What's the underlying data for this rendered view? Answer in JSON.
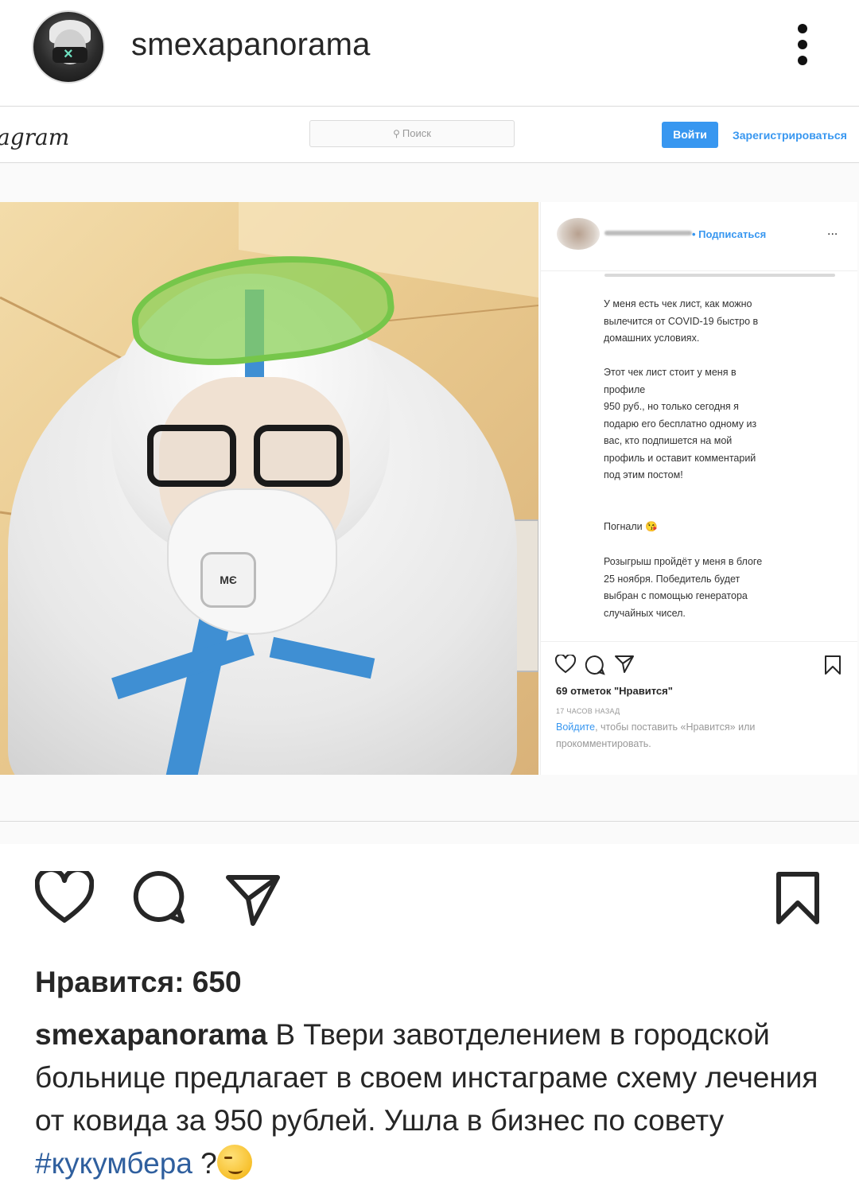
{
  "post": {
    "username": "smexapanorama",
    "likes_label": "Нравится: 650",
    "caption_user": "smexapanorama",
    "caption_text": " В Твери завотделением в городской больнице предлагает в своем инстаграме схему лечения от ковида за 950 рублей. Ушла в бизнес по совету ",
    "caption_hashtag": "#кукумбера",
    "caption_tail": " ?",
    "caption_emoji": "smirking-face-emoji"
  },
  "embedded": {
    "logo": "agram",
    "search_placeholder": "Поиск",
    "login_label": "Войти",
    "register_label": "Зарегистрироваться",
    "follow_label": "• Подписаться",
    "more_label": "...",
    "mask_text": "MЄ",
    "paragraph1": [
      "У меня есть чек лист, как можно",
      "вылечится от COVID-19 быстро в",
      "домашних условиях."
    ],
    "paragraph2": [
      "Этот чек лист стоит у меня в",
      "профиле",
      "950 руб., но только сегодня я",
      "подарю его бесплатно одному из",
      "вас, кто подпишется на мой",
      "профиль и оставит комментарий",
      "под этим постом!"
    ],
    "paragraph3": [
      "Погнали 😘"
    ],
    "paragraph4": [
      "Розыгрыш пройдёт у меня в блоге",
      "25 ноября. Победитель будет",
      "выбран с помощью генератора",
      "случайных чисел."
    ],
    "likes_label": "69 отметок \"Нравится\"",
    "time_label": "17 ЧАСОВ НАЗАД",
    "login_link": "Войдите",
    "login_rest": ", чтобы поставить «Нравится» или прокомментировать."
  },
  "colors": {
    "accent": "#3897f0",
    "hashtag": "#2f5f9e",
    "text": "#262626"
  }
}
